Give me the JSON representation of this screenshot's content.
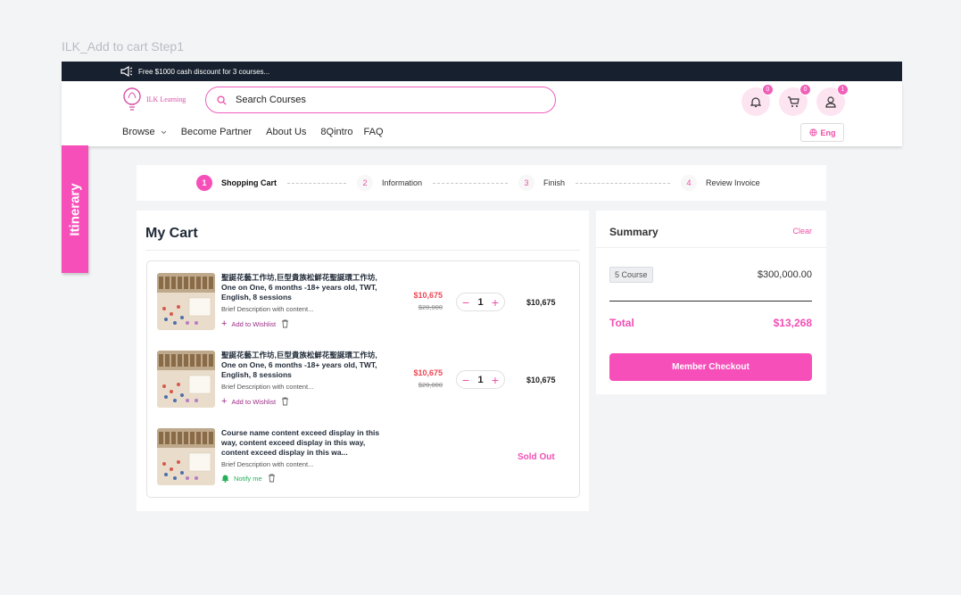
{
  "frame_label": "ILK_Add to cart Step1",
  "promo": {
    "text": "Free $1000 cash discount for 3 courses..."
  },
  "header": {
    "logo_text": "ILK Learning",
    "search_placeholder": "Search Courses",
    "badges": {
      "notifications": "0",
      "cart": "0",
      "profile": "1"
    },
    "nav": [
      "Browse",
      "Become Partner",
      "About Us",
      "8Qintro",
      "FAQ"
    ],
    "lang": "Eng"
  },
  "itinerary": "Itinerary",
  "steps": [
    {
      "num": "1",
      "label": "Shopping Cart"
    },
    {
      "num": "2",
      "label": "Information"
    },
    {
      "num": "3",
      "label": "Finish"
    },
    {
      "num": "4",
      "label": "Review Invoice"
    }
  ],
  "cart": {
    "title": "My Cart",
    "items": [
      {
        "name": "聖誕花藝工作坊,巨型貴族松鮮花聖誕環工作坊, One on One, 6 months -18+ years old, TWT, English, 8 sessions",
        "desc": "Brief Description with content...",
        "action": "Add to Wishlist",
        "price": "$10,675",
        "was": "$20,000",
        "qty": "1",
        "subtotal": "$10,675"
      },
      {
        "name": "聖誕花藝工作坊,巨型貴族松鮮花聖誕環工作坊, One on One, 6 months -18+ years old, TWT, English, 8 sessions",
        "desc": "Brief Description with content...",
        "action": "Add to Wishlist",
        "price": "$10,675",
        "was": "$20,000",
        "qty": "1",
        "subtotal": "$10,675"
      },
      {
        "name": "Course name content exceed display in this way,  content exceed display in this way, content exceed display in this wa...",
        "desc": "Brief Description with content...",
        "action": "Notify me",
        "status": "Sold Out"
      }
    ]
  },
  "summary": {
    "title": "Summary",
    "clear": "Clear",
    "course_tag": "5 Course",
    "course_amount": "$300,000.00",
    "total_label": "Total",
    "total_amount": "$13,268",
    "checkout": "Member Checkout"
  },
  "colors": {
    "accent": "#f64fb9",
    "dark_bar": "#17202e",
    "price_red": "#ef4552",
    "notify_green": "#27b05a"
  }
}
